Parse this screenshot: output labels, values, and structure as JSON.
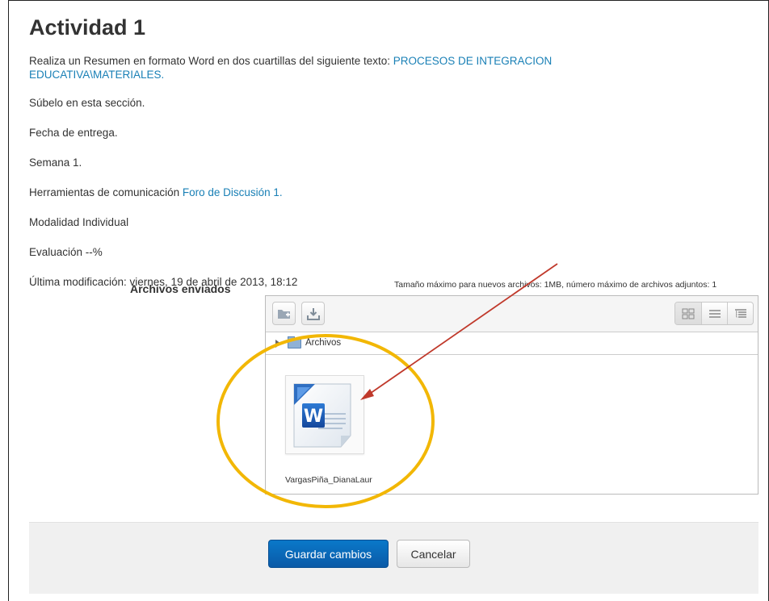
{
  "activity": {
    "title": "Actividad 1",
    "instruction_prefix": "Realiza un Resumen en formato Word en dos cuartillas del siguiente texto: ",
    "instruction_link_line1": "PROCESOS DE INTEGRACION",
    "instruction_link_line2": "EDUCATIVA\\MATERIALES.",
    "upload_text": "Súbelo en esta sección.",
    "due_label": "Fecha de entrega.",
    "week": "Semana 1.",
    "comm_tools_prefix": "Herramientas de comunicación ",
    "comm_tools_link": "Foro de Discusión 1.",
    "mode": "Modalidad Individual",
    "evaluation": "Evaluación --%",
    "last_modified": "Última modificación: viernes, 19 de abril de 2013, 18:12"
  },
  "submission": {
    "label": "Archivos enviados",
    "limits": "Tamaño máximo para nuevos archivos: 1MB, número máximo de archivos adjuntos: 1",
    "path": "Archivos",
    "files": [
      {
        "name": "VargasPiña_DianaLaur",
        "icon": "word-document-icon"
      }
    ]
  },
  "toolbar": {
    "icons": [
      "create-folder-icon",
      "download-icon",
      "view-icons-icon",
      "view-list-icon",
      "view-tree-icon"
    ]
  },
  "buttons": {
    "save": "Guardar cambios",
    "cancel": "Cancelar"
  },
  "colors": {
    "link": "#1a80b6",
    "primary_button": "#0a6ab8",
    "highlight_circle": "#f2b705",
    "annotation_arrow": "#c0392b"
  }
}
